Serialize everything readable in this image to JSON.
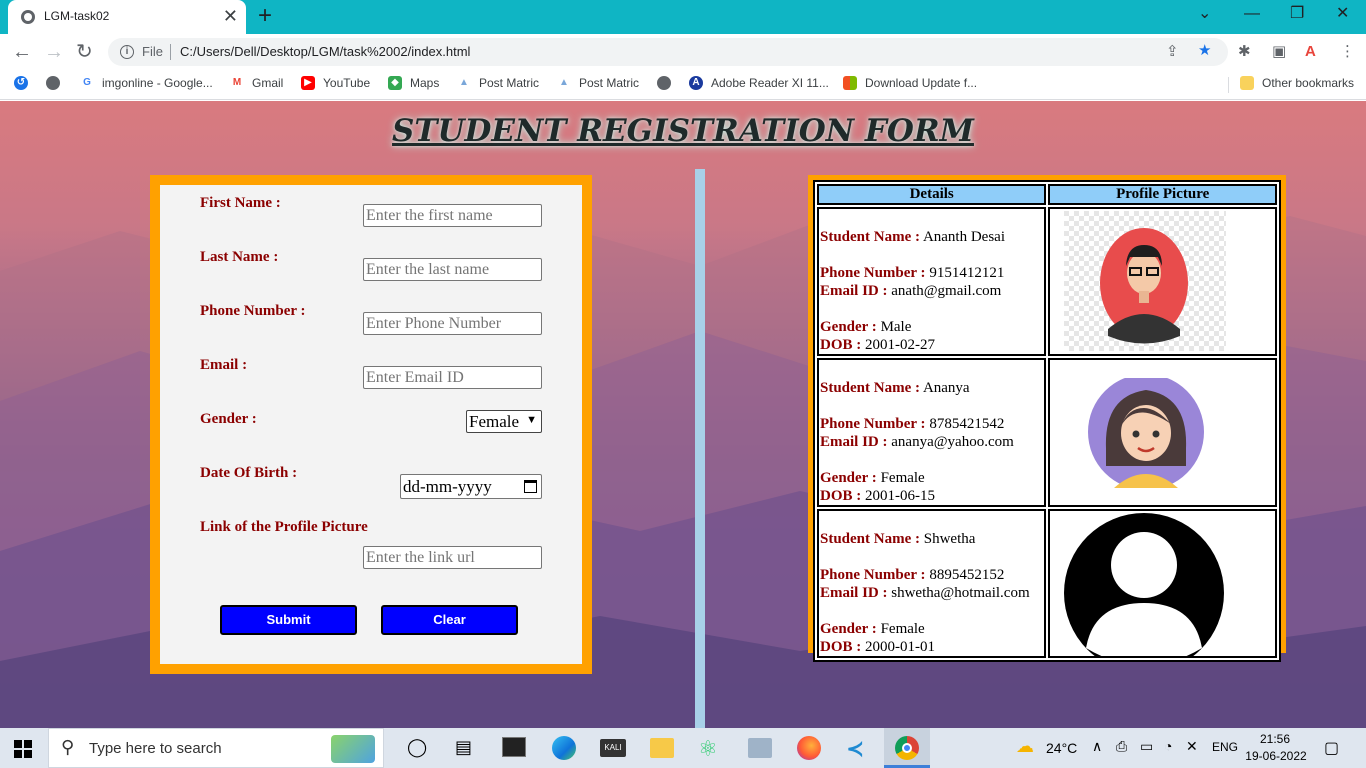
{
  "browser": {
    "tab_title": "LGM-task02",
    "url_scheme": "File",
    "url": "C:/Users/Dell/Desktop/LGM/task%2002/index.html",
    "bookmarks": [
      {
        "label": "imgonline - Google...",
        "icon": "google-icon"
      },
      {
        "label": "Gmail",
        "icon": "gmail-icon"
      },
      {
        "label": "YouTube",
        "icon": "youtube-icon"
      },
      {
        "label": "Maps",
        "icon": "maps-icon"
      },
      {
        "label": "Post Matric",
        "icon": "post-matric-icon"
      },
      {
        "label": "Post Matric",
        "icon": "post-matric-icon"
      },
      {
        "label": "Adobe Reader XI 11...",
        "icon": "adobe-reader-icon"
      },
      {
        "label": "Download Update f...",
        "icon": "microsoft-icon"
      }
    ],
    "other_bookmarks": "Other bookmarks"
  },
  "page": {
    "title": "STUDENT REGISTRATION FORM"
  },
  "form": {
    "first_name_label": "First Name :",
    "first_name_placeholder": "Enter the first name",
    "last_name_label": "Last Name :",
    "last_name_placeholder": "Enter the last name",
    "phone_label": "Phone Number :",
    "phone_placeholder": "Enter Phone Number",
    "email_label": "Email :",
    "email_placeholder": "Enter Email ID",
    "gender_label": "Gender :",
    "gender_value": "Female",
    "dob_label": "Date Of Birth :",
    "dob_placeholder": "dd-mm-yyyy",
    "pic_label": "Link of the Profile Picture",
    "pic_placeholder": "Enter the link url",
    "submit_label": "Submit",
    "clear_label": "Clear"
  },
  "table": {
    "col_details": "Details",
    "col_picture": "Profile Picture",
    "key_name": "Student Name :",
    "key_phone": "Phone Number :",
    "key_email": "Email ID :",
    "key_gender": "Gender :",
    "key_dob": "DOB :",
    "rows": [
      {
        "name": "Ananth Desai",
        "phone": "9151412121",
        "email": "anath@gmail.com",
        "gender": "Male",
        "dob": "2001-02-27",
        "avatar": "male-avatar-icon"
      },
      {
        "name": "Ananya",
        "phone": "8785421542",
        "email": "ananya@yahoo.com",
        "gender": "Female",
        "dob": "2001-06-15",
        "avatar": "female-avatar-icon"
      },
      {
        "name": "Shwetha",
        "phone": "8895452152",
        "email": "shwetha@hotmail.com",
        "gender": "Female",
        "dob": "2000-01-01",
        "avatar": "default-user-icon"
      }
    ]
  },
  "taskbar": {
    "search_placeholder": "Type here to search",
    "weather": "24°C",
    "lang": "ENG",
    "time": "21:56",
    "date": "19-06-2022"
  }
}
